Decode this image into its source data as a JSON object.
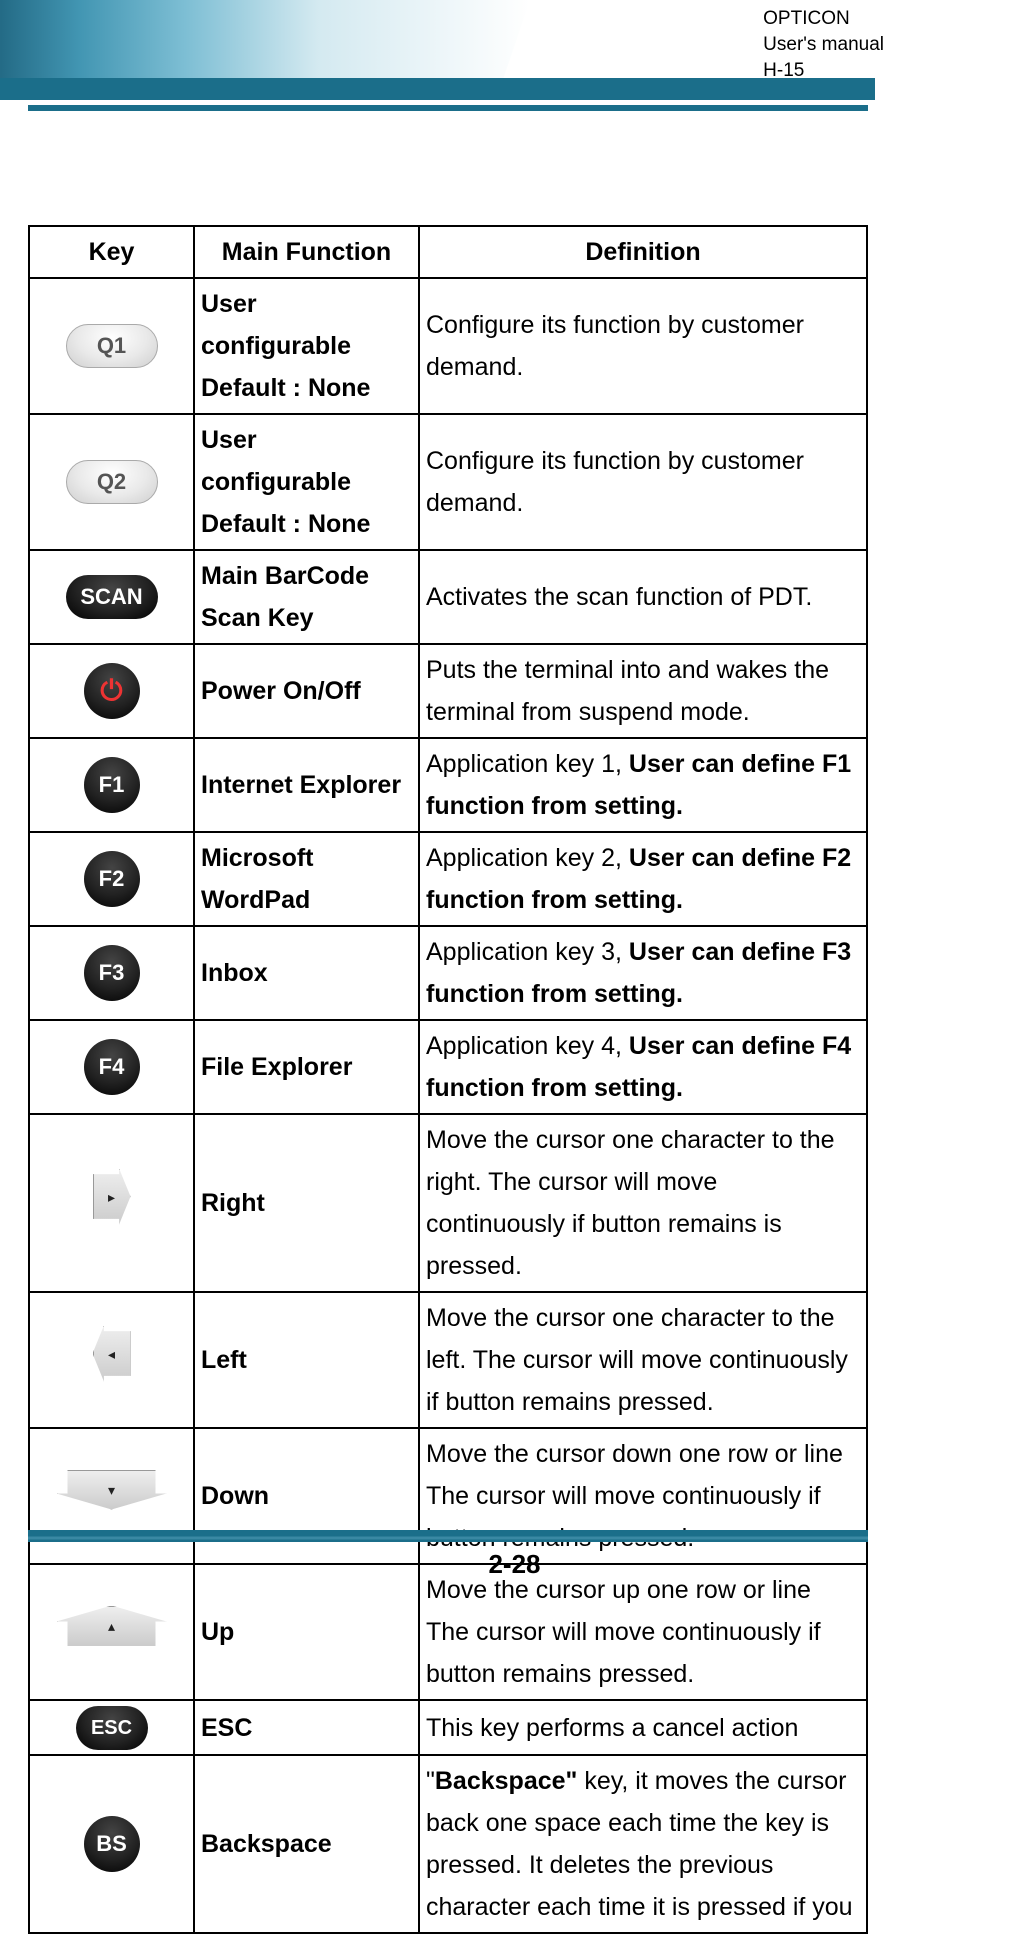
{
  "header": {
    "brand": "OPTICON",
    "title": "User's manual",
    "model": "H-15"
  },
  "page_number": "2-28",
  "table": {
    "columns": [
      "Key",
      "Main Function",
      "Definition"
    ],
    "rows": [
      {
        "key_label": "Q1",
        "key_style": "oval-light",
        "fn_line1": "User configurable",
        "fn_line2": "Default : None",
        "def_pre": "Configure its function by ",
        "def_var": "customer demand",
        "def_post": "."
      },
      {
        "key_label": "Q2",
        "key_style": "oval-light",
        "fn_line1": "User configurable",
        "fn_line2": "Default : None",
        "def_pre": "Configure its function by ",
        "def_var": "customer demand",
        "def_post": "."
      },
      {
        "key_label": "SCAN",
        "key_style": "oval-dark",
        "fn_line1": "Main BarCode",
        "fn_line2": "Scan Key",
        "def": "Activates the scan function of PDT."
      },
      {
        "key_label": "⏻",
        "key_style": "round-dark red",
        "fn_line1": "Power On/Off",
        "def": "Puts the terminal into and wakes the terminal from suspend mode."
      },
      {
        "key_label": "F1",
        "key_style": "round-dark",
        "fn_line1": "Internet Explorer",
        "def_pre": "Application key 1, ",
        "def_bold": "User can define F1 function from setting."
      },
      {
        "key_label": "F2",
        "key_style": "round-dark",
        "fn_line1": "Microsoft",
        "fn_line2": "WordPad",
        "def_pre": "Application key 2, ",
        "def_bold": "User can define F2 function from setting."
      },
      {
        "key_label": "F3",
        "key_style": "round-dark",
        "fn_line1": "Inbox",
        "def_pre": "Application key 3, ",
        "def_bold": "User can define F3 function from setting."
      },
      {
        "key_label": "F4",
        "key_style": "round-dark",
        "fn_line1": "File Explorer",
        "def_pre": "Application key 4, ",
        "def_bold": "User can define F4 function from setting."
      },
      {
        "key_label": "▸",
        "key_style": "arrow-r",
        "fn_line1": "Right",
        "def": "Move the cursor one character to the right. The cursor will move continuously if button remains is pressed."
      },
      {
        "key_label": "◂",
        "key_style": "arrow-l",
        "fn_line1": "Left",
        "def": "Move the cursor one character to the left. The cursor will move continuously if button remains pressed."
      },
      {
        "key_label": "▾",
        "key_style": "arrow-d",
        "fn_line1": "Down",
        "def": "Move the cursor down one row or line The cursor will move continuously if button remains pressed."
      },
      {
        "key_label": "▴",
        "key_style": "arrow-u",
        "fn_line1": "Up",
        "def": "Move the cursor up one row or line The cursor will move continuously if button remains pressed."
      },
      {
        "key_label": "ESC",
        "key_style": "oval-dark small",
        "fn_line1": "ESC",
        "def": "This key performs a cancel action"
      },
      {
        "key_label": "BS",
        "key_style": "round-dark",
        "fn_line1": "Backspace",
        "def_quote_open": "\"",
        "def_bold": "Backspace\"",
        "def_post": " key, it moves the cursor back one space each time the key is pressed. It deletes the previous character each time it is pressed if you"
      }
    ]
  }
}
